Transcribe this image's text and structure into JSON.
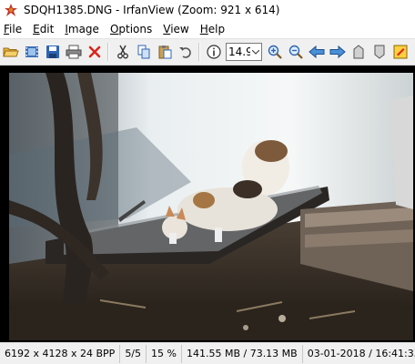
{
  "window": {
    "title": "SDQH1385.DNG - IrfanView (Zoom: 921 x 614)"
  },
  "menu": {
    "items": [
      {
        "label": "File",
        "key": "F"
      },
      {
        "label": "Edit",
        "key": "E"
      },
      {
        "label": "Image",
        "key": "I"
      },
      {
        "label": "Options",
        "key": "O"
      },
      {
        "label": "View",
        "key": "V"
      },
      {
        "label": "Help",
        "key": "H"
      }
    ]
  },
  "toolbar": {
    "zoom_value": "14.9",
    "buttons": [
      "open-icon",
      "slideshow-icon",
      "save-icon",
      "print-icon",
      "delete-icon",
      "cut-icon",
      "copy-icon",
      "paste-icon",
      "undo-icon",
      "info-icon",
      "zoom-in-icon",
      "zoom-out-icon",
      "prev-icon",
      "next-icon",
      "first-icon",
      "last-icon",
      "paint-icon"
    ]
  },
  "status": {
    "dimensions": "6192 x 4128 x 24 BPP",
    "index": "5/5",
    "zoom": "15 %",
    "filesize": "141.55 MB / 73.13 MB",
    "datetime": "03-01-2018 / 16:41:33"
  },
  "colors": {
    "toolbar_bg": "#f0f0f0",
    "viewer_bg": "#000000"
  }
}
